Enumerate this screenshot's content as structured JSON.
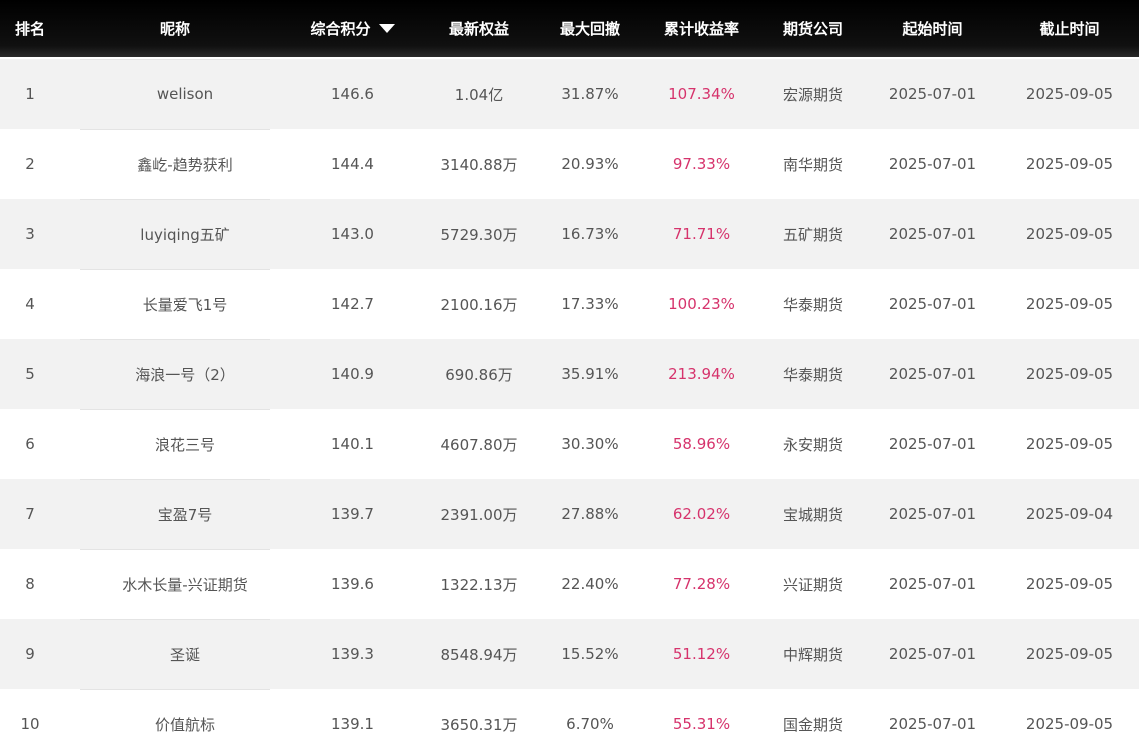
{
  "headers": {
    "rank": "排名",
    "nickname": "昵称",
    "score": "综合积分",
    "equity": "最新权益",
    "drawdown": "最大回撤",
    "return": "累计收益率",
    "company": "期货公司",
    "start": "起始时间",
    "end": "截止时间"
  },
  "colors": {
    "header_bg": "#000000",
    "header_text": "#ffffff",
    "return_text": "#d6336c",
    "row_alt": "#f2f2f2"
  },
  "icons": {
    "sort": "sort-down-icon"
  },
  "rows": [
    {
      "rank": "1",
      "nickname": "welison",
      "score": "146.6",
      "equity": "1.04亿",
      "drawdown": "31.87%",
      "return": "107.34%",
      "company": "宏源期货",
      "start": "2025-07-01",
      "end": "2025-09-05"
    },
    {
      "rank": "2",
      "nickname": "鑫屹-趋势获利",
      "score": "144.4",
      "equity": "3140.88万",
      "drawdown": "20.93%",
      "return": "97.33%",
      "company": "南华期货",
      "start": "2025-07-01",
      "end": "2025-09-05"
    },
    {
      "rank": "3",
      "nickname": "luyiqing五矿",
      "score": "143.0",
      "equity": "5729.30万",
      "drawdown": "16.73%",
      "return": "71.71%",
      "company": "五矿期货",
      "start": "2025-07-01",
      "end": "2025-09-05"
    },
    {
      "rank": "4",
      "nickname": "长量爱飞1号",
      "score": "142.7",
      "equity": "2100.16万",
      "drawdown": "17.33%",
      "return": "100.23%",
      "company": "华泰期货",
      "start": "2025-07-01",
      "end": "2025-09-05"
    },
    {
      "rank": "5",
      "nickname": "海浪一号（2）",
      "score": "140.9",
      "equity": "690.86万",
      "drawdown": "35.91%",
      "return": "213.94%",
      "company": "华泰期货",
      "start": "2025-07-01",
      "end": "2025-09-05"
    },
    {
      "rank": "6",
      "nickname": "浪花三号",
      "score": "140.1",
      "equity": "4607.80万",
      "drawdown": "30.30%",
      "return": "58.96%",
      "company": "永安期货",
      "start": "2025-07-01",
      "end": "2025-09-05"
    },
    {
      "rank": "7",
      "nickname": "宝盈7号",
      "score": "139.7",
      "equity": "2391.00万",
      "drawdown": "27.88%",
      "return": "62.02%",
      "company": "宝城期货",
      "start": "2025-07-01",
      "end": "2025-09-04"
    },
    {
      "rank": "8",
      "nickname": "水木长量-兴证期货",
      "score": "139.6",
      "equity": "1322.13万",
      "drawdown": "22.40%",
      "return": "77.28%",
      "company": "兴证期货",
      "start": "2025-07-01",
      "end": "2025-09-05"
    },
    {
      "rank": "9",
      "nickname": "圣诞",
      "score": "139.3",
      "equity": "8548.94万",
      "drawdown": "15.52%",
      "return": "51.12%",
      "company": "中辉期货",
      "start": "2025-07-01",
      "end": "2025-09-05"
    },
    {
      "rank": "10",
      "nickname": "价值航标",
      "score": "139.1",
      "equity": "3650.31万",
      "drawdown": "6.70%",
      "return": "55.31%",
      "company": "国金期货",
      "start": "2025-07-01",
      "end": "2025-09-05"
    }
  ]
}
